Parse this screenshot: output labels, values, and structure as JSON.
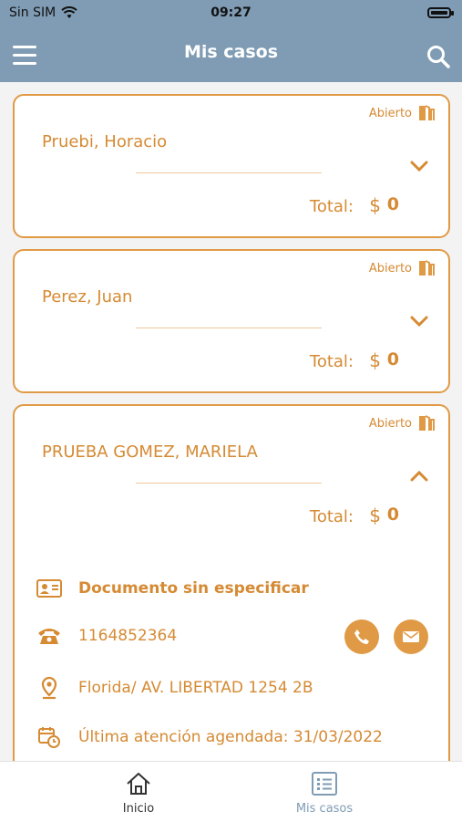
{
  "status_bar": {
    "carrier": "Sin SIM",
    "time": "09:27"
  },
  "header": {
    "title": "Mis casos"
  },
  "cases": [
    {
      "status": "Abierto",
      "name": "Pruebi, Horacio",
      "total_label": "Total:",
      "currency": "$",
      "amount": "0"
    },
    {
      "status": "Abierto",
      "name": "Perez, Juan",
      "total_label": "Total:",
      "currency": "$",
      "amount": "0"
    },
    {
      "status": "Abierto",
      "name": "PRUEBA GOMEZ, MARIELA",
      "total_label": "Total:",
      "currency": "$",
      "amount": "0",
      "details": {
        "document": "Documento sin especificar",
        "phone": "1164852364",
        "address": "Florida/ AV. LIBERTAD 1254 2B",
        "last_appointment": "Última atención agendada: 31/03/2022"
      }
    }
  ],
  "tabs": [
    {
      "label": "Inicio",
      "icon": "home-icon",
      "active": false
    },
    {
      "label": "Mis casos",
      "icon": "list-icon",
      "active": true
    }
  ],
  "colors": {
    "header": "#7f9cb4",
    "accent": "#e09a45",
    "text_accent": "#d58a33",
    "tab_active": "#7f9cb4"
  }
}
